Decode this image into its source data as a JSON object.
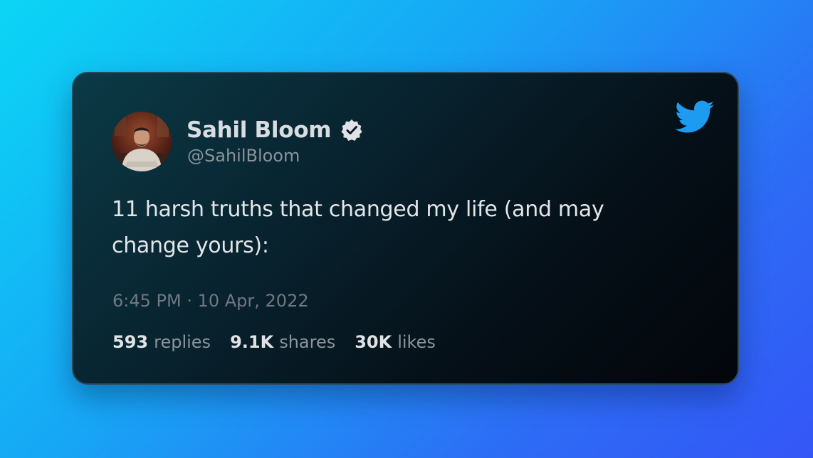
{
  "tweet": {
    "author": {
      "name": "Sahil Bloom",
      "handle": "@SahilBloom",
      "verified": true
    },
    "text": "11 harsh truths that changed my life (and may change yours):",
    "timestamp": "6:45 PM · 10 Apr, 2022",
    "stats": [
      {
        "value": "593",
        "label": "replies"
      },
      {
        "value": "9.1K",
        "label": "shares"
      },
      {
        "value": "30K",
        "label": "likes"
      }
    ]
  },
  "icons": {
    "brand": "twitter-bird-icon",
    "badge": "verified-badge-icon"
  },
  "colors": {
    "background_start": "#0bd6f5",
    "background_end": "#3456f6",
    "card_background": "#06141c",
    "twitter_blue": "#1d9bf0"
  }
}
